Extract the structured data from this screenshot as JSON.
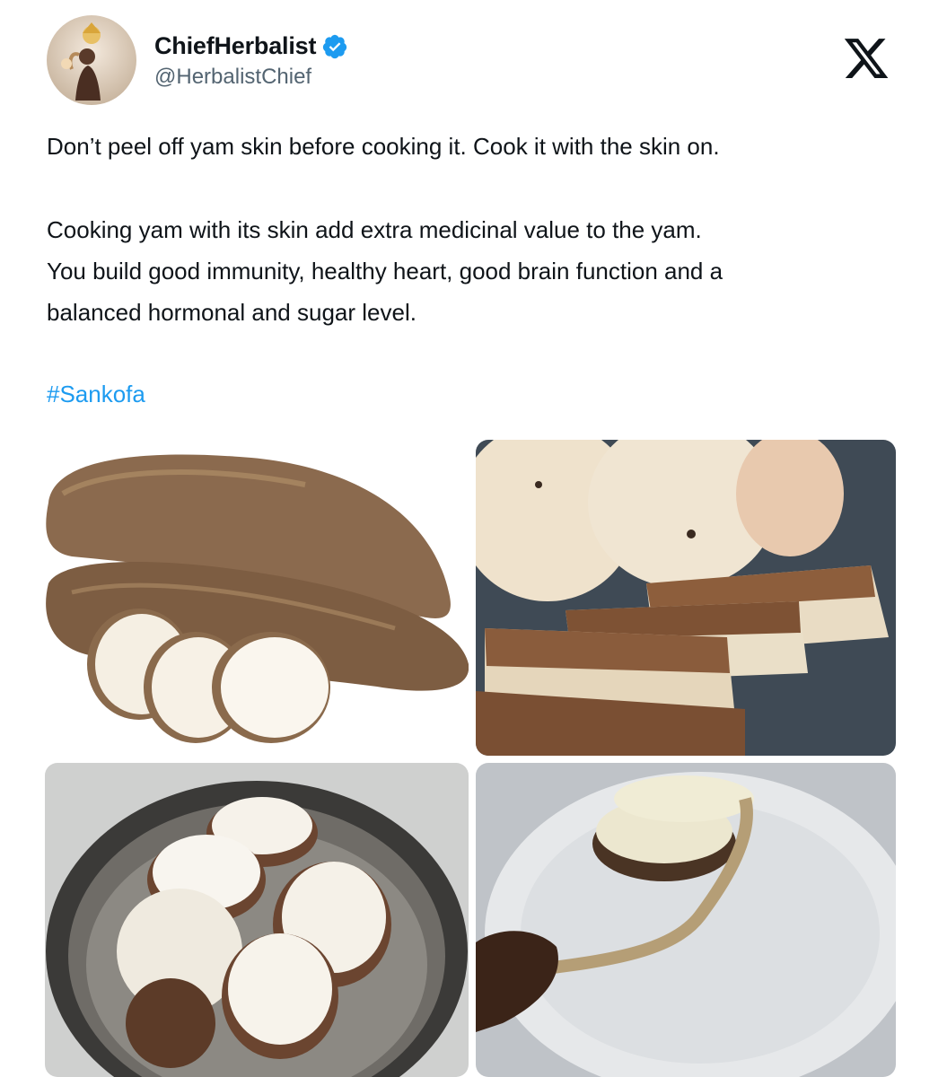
{
  "author": {
    "display_name": "ChiefHerbalist",
    "handle": "@HerbalistChief",
    "verified": true
  },
  "platform_icon": "x-logo-icon",
  "tweet": {
    "paragraph_1": "Don’t peel off yam skin before cooking it. Cook it with the skin on.",
    "paragraph_2_line_1": "Cooking yam with its skin add extra medicinal value to the yam.",
    "paragraph_2_line_2": "You build good immunity, healthy heart, good brain function and a",
    "paragraph_2_line_3": "balanced hormonal and sugar level.",
    "hashtag": "#Sankofa"
  },
  "colors": {
    "link": "#1d9bf0",
    "verified_badge": "#1d9bf0",
    "text": "#0f1419",
    "secondary_text": "#536471"
  },
  "media": [
    {
      "name": "whole-yam-with-slices-photo"
    },
    {
      "name": "sliced-yam-closeup-photo"
    },
    {
      "name": "yam-in-pot-photo"
    },
    {
      "name": "peeled-yam-on-plate-photo"
    }
  ]
}
